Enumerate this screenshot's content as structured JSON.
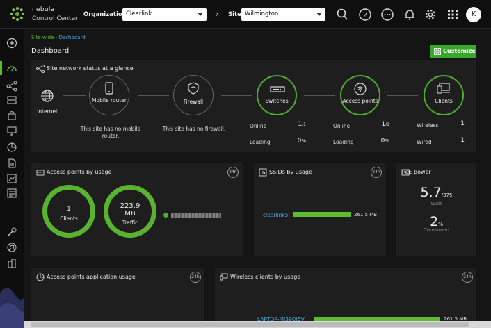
{
  "brand": {
    "line1": "nebula",
    "line2": "Control Center"
  },
  "header": {
    "org_label": "Organization:",
    "org_value": "Clearlink",
    "site_label": "Site:",
    "site_value": "Wilmington",
    "avatar_initial": "K"
  },
  "breadcrumb": {
    "root": "Site-wide",
    "current": "Dashboard"
  },
  "page_title": "Dashboard",
  "customize_label": "Customize",
  "status_panel": {
    "title": "Site network status at a glance",
    "internet": "Internet",
    "mobile_router": "Mobile router",
    "firewall": "Firewall",
    "switches": "Switches",
    "access_points": "Access points",
    "clients": "Clients",
    "no_mobile": "This site has no mobile router.",
    "no_firewall": "This site has no firewall.",
    "switch_online_label": "Online",
    "switch_online_value": "1",
    "switch_online_total": "/1",
    "switch_loading_label": "Loading",
    "switch_loading_value": "0",
    "switch_loading_unit": "%",
    "ap_online_label": "Online",
    "ap_online_value": "1",
    "ap_online_total": "/1",
    "ap_loading_label": "Loading",
    "ap_loading_value": "0",
    "ap_loading_unit": "%",
    "wireless_label": "Wireless",
    "wireless_value": "1",
    "wired_label": "Wired",
    "wired_value": "1"
  },
  "ap_usage": {
    "title": "Access points by usage",
    "badge": "24h",
    "clients_value": "1",
    "clients_label": "Clients",
    "traffic_value": "223.9",
    "traffic_unit": "MB",
    "traffic_label": "Traffic"
  },
  "ssid_usage": {
    "title": "SSIDs by usage",
    "badge": "24h",
    "ssid_name": "clearlink5",
    "ssid_value": "261.5 MB",
    "ssid_fill": 1.0
  },
  "poe": {
    "title": "PoE power",
    "watt_value": "5.7",
    "watt_total": "/375",
    "watt_label": "Watt",
    "pct_value": "2",
    "pct_unit": "%",
    "pct_label": "Consumed"
  },
  "app_usage": {
    "title": "Access points application usage",
    "badge": "24h"
  },
  "wireless_clients": {
    "title": "Wireless clients by usage",
    "badge": "24h",
    "client_name": "LAPTOP-MJ39OI5V",
    "client_value": "261.5 MB"
  },
  "colors": {
    "accent": "#4cae2e",
    "link": "#4aa8e0",
    "background": "#151515",
    "panel": "#1e1e1e"
  },
  "icons": [
    "search-icon",
    "help-icon",
    "more-icon",
    "bell-icon",
    "gear-icon",
    "apps-grid-icon"
  ]
}
